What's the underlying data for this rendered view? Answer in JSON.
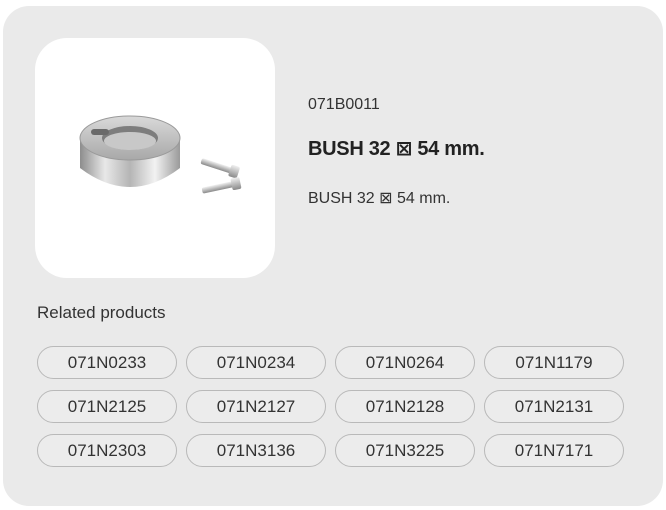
{
  "product": {
    "code": "071B0011",
    "title": "BUSH 32 ⊠ 54 mm.",
    "description": "BUSH 32 ⊠ 54 mm.",
    "image_icon": "bush-with-screws-image"
  },
  "related": {
    "label": "Related products",
    "items": [
      "071N0233",
      "071N0234",
      "071N0264",
      "071N1179",
      "071N2125",
      "071N2127",
      "071N2128",
      "071N2131",
      "071N2303",
      "071N3136",
      "071N3225",
      "071N7171"
    ]
  },
  "colors": {
    "card_background": "#eaeaea",
    "pill_border": "#b9b9b9"
  }
}
